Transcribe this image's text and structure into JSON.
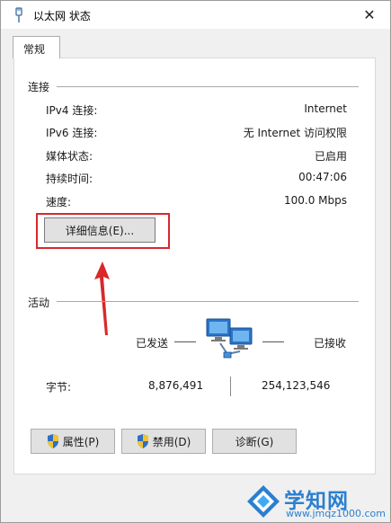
{
  "window": {
    "title": "以太网 状态",
    "close_symbol": "✕"
  },
  "tab": {
    "label": "常规"
  },
  "connection": {
    "section_label": "连接",
    "rows": [
      {
        "label": "IPv4 连接:",
        "value": "Internet"
      },
      {
        "label": "IPv6 连接:",
        "value": "无 Internet 访问权限"
      },
      {
        "label": "媒体状态:",
        "value": "已启用"
      },
      {
        "label": "持续时间:",
        "value": "00:47:06"
      },
      {
        "label": "速度:",
        "value": "100.0 Mbps"
      }
    ],
    "details_button": "详细信息(E)..."
  },
  "activity": {
    "section_label": "活动",
    "sent_label": "已发送",
    "received_label": "已接收",
    "bytes_label": "字节:",
    "bytes_sent": "8,876,491",
    "bytes_received": "254,123,546"
  },
  "buttons": {
    "properties": "属性(P)",
    "disable": "禁用(D)",
    "diagnose": "诊断(G)"
  },
  "watermark": {
    "brand": "学知网",
    "url": "www.jmqz1000.com"
  },
  "colors": {
    "highlight": "#d8282c",
    "watermark": "#2a7fd0"
  }
}
